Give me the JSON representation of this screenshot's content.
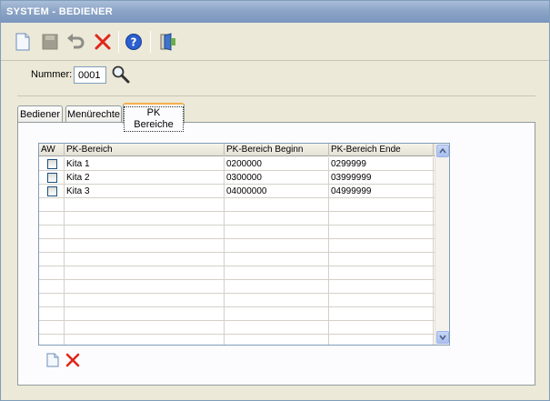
{
  "window": {
    "title": "SYSTEM - BEDIENER"
  },
  "toolbar": {
    "buttons": [
      {
        "name": "new-document-icon"
      },
      {
        "name": "save-icon"
      },
      {
        "name": "undo-icon"
      },
      {
        "name": "delete-icon"
      },
      {
        "name": "help-icon"
      },
      {
        "name": "exit-door-icon"
      }
    ]
  },
  "nummer": {
    "label": "Nummer:",
    "value": "0001"
  },
  "tabs": [
    {
      "label": "Bediener",
      "active": false
    },
    {
      "label": "Menürechte",
      "active": false
    },
    {
      "label": "PK Bereiche",
      "active": true
    }
  ],
  "grid": {
    "columns": [
      "AW",
      "PK-Bereich",
      "PK-Bereich Beginn",
      "PK-Bereich Ende"
    ],
    "rows": [
      {
        "aw": false,
        "bereich": "Kita 1",
        "beginn": "0200000",
        "ende": "0299999"
      },
      {
        "aw": false,
        "bereich": "Kita 2",
        "beginn": "0300000",
        "ende": "03999999"
      },
      {
        "aw": false,
        "bereich": "Kita 3",
        "beginn": "04000000",
        "ende": "04999999"
      }
    ]
  },
  "colors": {
    "title_bar": "#8aa3c6",
    "active_tab_accent": "#f5b04a",
    "delete_red": "#e0261b",
    "help_blue": "#2b5fcf"
  }
}
